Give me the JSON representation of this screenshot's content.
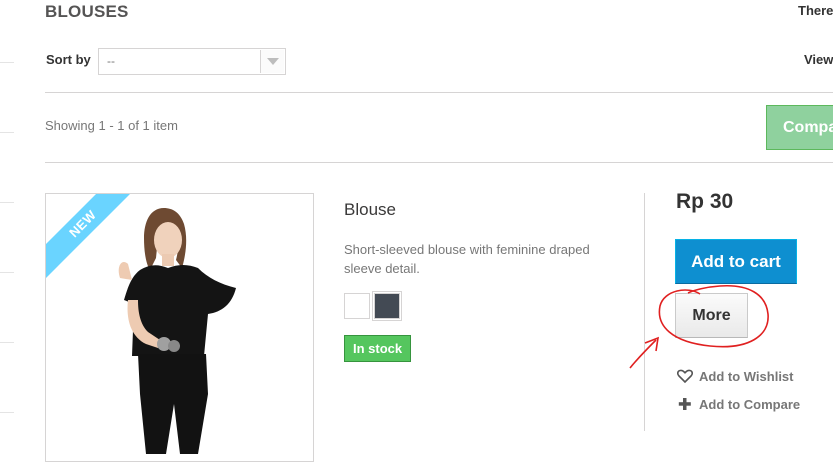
{
  "header": {
    "title": "BLOUSES",
    "right_fragment": "There"
  },
  "toolbar": {
    "sort_label": "Sort by",
    "sort_value": "--",
    "view_fragment": "View"
  },
  "results": {
    "showing": "Showing 1 - 1 of 1 item",
    "compare_button_fragment": "Compa"
  },
  "product": {
    "badge": "NEW",
    "name": "Blouse",
    "description": "Short-sleeved blouse with feminine draped sleeve detail.",
    "colors": [
      "#ffffff",
      "#434a54"
    ],
    "availability": "In stock",
    "price": "Rp 30",
    "add_to_cart_label": "Add to cart",
    "more_label": "More",
    "wishlist_label": "Add to Wishlist",
    "compare_label": "Add to Compare"
  },
  "icons": {
    "wishlist": "heart-icon",
    "compare": "plus-icon"
  },
  "colors": {
    "accent_blue": "#0e8fd0",
    "ribbon": "#6ad4ff",
    "in_stock": "#55c65e",
    "annotation": "#e02020"
  }
}
